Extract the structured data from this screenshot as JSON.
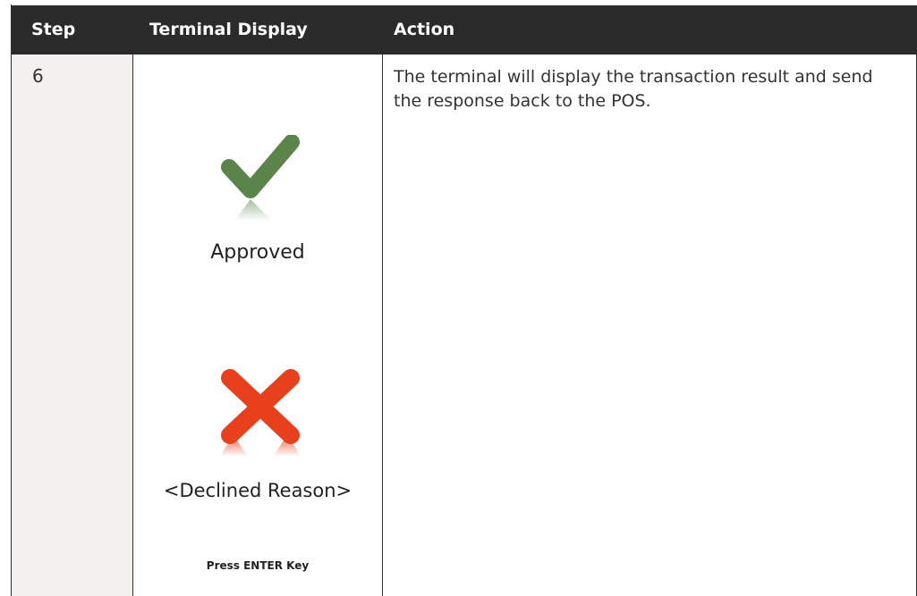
{
  "table": {
    "headers": {
      "step": "Step",
      "display": "Terminal Display",
      "action": "Action"
    },
    "rows": [
      {
        "step": "6",
        "display": {
          "approved_icon": "green-checkmark-icon",
          "approved_label": "Approved",
          "declined_icon": "red-x-icon",
          "declined_label": "<Declined Reason>",
          "enter_label": "Press ENTER Key"
        },
        "action": "The terminal will display the transaction result and send the response back to the POS."
      }
    ]
  },
  "colors": {
    "header_bg": "#2b2b2b",
    "step_col_bg": "#f3f0ee",
    "approved": "#5b844b",
    "declined": "#e8401c"
  }
}
